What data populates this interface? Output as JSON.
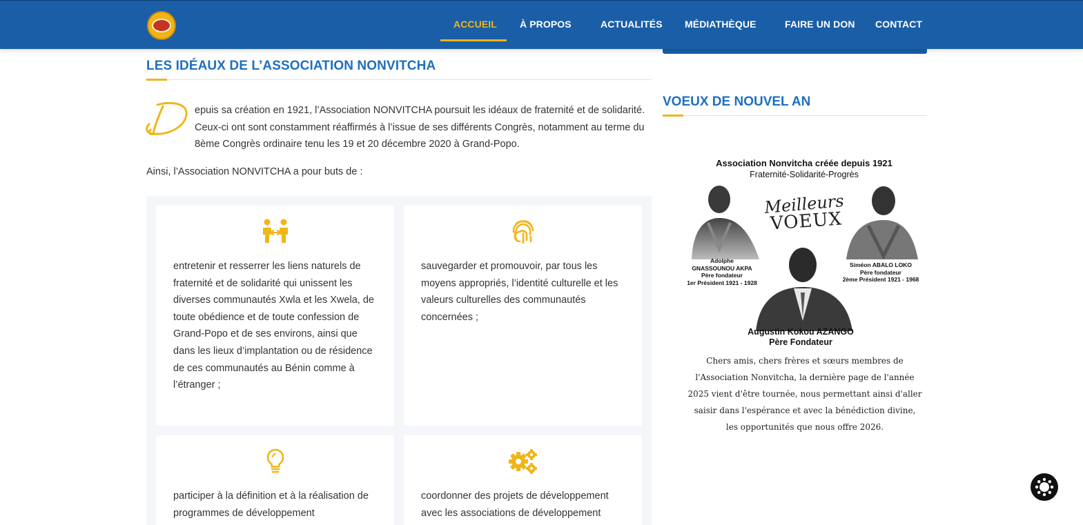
{
  "header": {
    "logo_alt": "Association Nonvitcha",
    "nav": [
      {
        "label": "ACCUEIL",
        "active": true
      },
      {
        "label": "À PROPOS",
        "active": false
      },
      {
        "label": "ACTUALITÉS",
        "active": false
      },
      {
        "label": "MÉDIATHÈQUE",
        "active": false
      },
      {
        "label": "FAIRE UN DON",
        "active": false
      },
      {
        "label": "CONTACT",
        "active": false
      }
    ]
  },
  "main": {
    "title": "LES IDÉAUX DE L’ASSOCIATION NONVITCHA",
    "dropcap": "D",
    "intro": "epuis sa création en 1921, l’Association NONVITCHA poursuit les idéaux de fraternité et de solidarité. Ceux-ci ont sont constamment réaffirmés à l’issue de ses différents Congrès, notamment au terme du 8ème Congrès ordinaire tenu les 19 et 20 décembre 2020 à Grand-Popo.",
    "intro2": "Ainsi, l’Association NONVITCHA a pour buts de :",
    "goals": [
      {
        "icon": "handshake-people-icon",
        "text": "entretenir et resserrer les liens naturels de fraternité et de solidarité qui unissent les diverses communautés Xwla et les Xwela, de toute obédience et de toute confession de Grand-Popo et de ses environs, ainsi que dans les lieux d’implantation ou de résidence de ces communautés au Bénin comme à l’étranger ;"
      },
      {
        "icon": "fingerprint-icon",
        "text": "sauvegarder et promouvoir, par tous les moyens appropriés, l’identité culturelle et les valeurs culturelles des communautés concernées ;"
      },
      {
        "icon": "lightbulb-icon",
        "text": "participer à la définition et à la réalisation de programmes de développement"
      },
      {
        "icon": "gears-icon",
        "text": "coordonner des projets de développement avec les associations de développement"
      }
    ]
  },
  "sidebar": {
    "title": "VOEUX DE NOUVEL AN",
    "poster": {
      "title": "Association Nonvitcha créée depuis 1921",
      "subtitle": "Fraternité-Solidarité-Progrès",
      "greeting_line1": "Meilleurs",
      "greeting_line2": "VOEUX",
      "left_caption": "Adolphe\nGNASSOUNOU AKPA\nPère fondateur\n1er Président 1921 - 1928",
      "right_caption": "Siméon ABALO LOKO\nPère fondateur\n2ème Président 1921 - 1968",
      "main_caption_name": "Augustin Kokou AZANGO",
      "main_caption_role": "Père Fondateur",
      "message": "Chers amis, chers frères et sœurs membres de l'Association Nonvitcha, la dernière page de l'année 2025 vient d'être tournée, nous permettant ainsi d'aller saisir dans l'espérance et avec la bénédiction divine, les opportunités que nous offre 2026."
    }
  },
  "accessibility_button": {
    "icon": "accessibility-icon"
  },
  "colors": {
    "brand_blue": "#1a5ea7",
    "accent_gold": "#f0b51a",
    "title_blue": "#1e6fbf"
  }
}
